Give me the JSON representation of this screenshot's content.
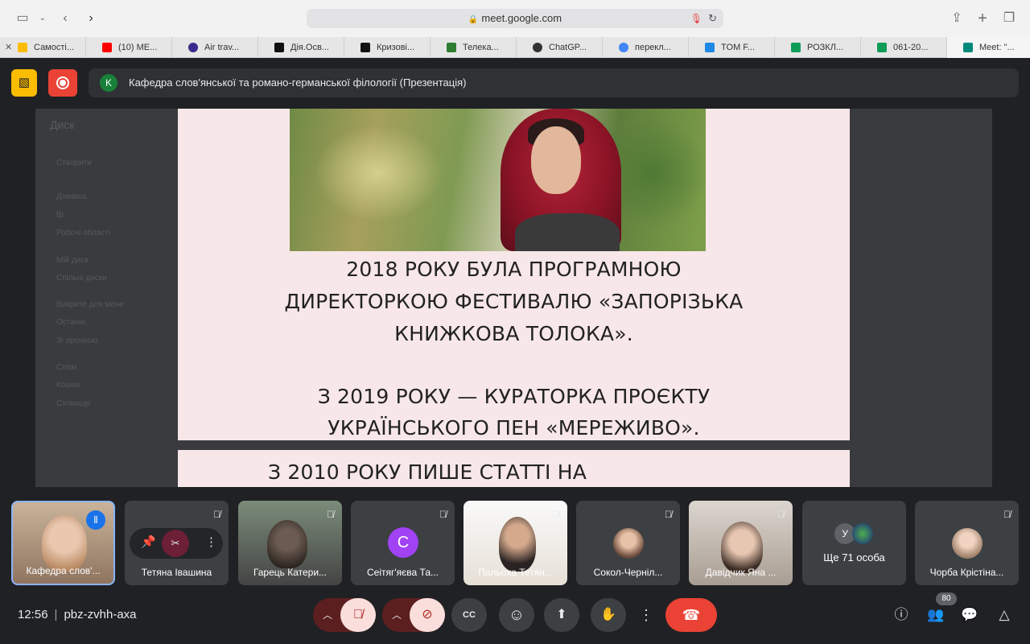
{
  "browser": {
    "url": "meet.google.com"
  },
  "tabs": [
    {
      "label": "Самості...",
      "color": "#fbbc04"
    },
    {
      "label": "(10) ME...",
      "color": "#ff0000"
    },
    {
      "label": "Air trav...",
      "color": "#3c2a8c"
    },
    {
      "label": "Дія.Осв...",
      "color": "#111111"
    },
    {
      "label": "Кризові...",
      "color": "#111111"
    },
    {
      "label": "Телека...",
      "color": "#2e7d32"
    },
    {
      "label": "ChatGP...",
      "color": "#333333"
    },
    {
      "label": "перекл...",
      "color": "#4285f4"
    },
    {
      "label": "TOM F...",
      "color": "#1e88e5"
    },
    {
      "label": "РОЗКЛ...",
      "color": "#0f9d58"
    },
    {
      "label": "061-20...",
      "color": "#0f9d58"
    },
    {
      "label": "Meet: \"...",
      "color": "#00897b"
    }
  ],
  "meeting": {
    "presenter_initial": "K",
    "title": "Кафедра слов'янської та романо-германської філології (Презентація)",
    "time": "12:56",
    "code": "pbz-zvhh-axa",
    "participant_count": "80"
  },
  "drive_bg": {
    "logo": "Диск",
    "items": [
      "Створити",
      "Домівка",
      "Ві",
      "Робочі області",
      "Мій диск",
      "Спільні диски",
      "Викрите для мене",
      "Останні",
      "Зі зірочкою",
      "Спам",
      "Кошик",
      "Сховище"
    ]
  },
  "slide": {
    "lines": [
      "2018 РОКУ БУЛА ПРОГРАМНОЮ",
      "ДИРЕКТОРКОЮ ФЕСТИВАЛЮ «ЗАПОРІЗЬКА",
      "КНИЖКОВА ТОЛОКА».",
      "",
      "З 2019 РОКУ — КУРАТОРКА ПРОЄКТУ",
      "УКРАЇНСЬКОГО ПЕН «МЕРЕЖИВО»."
    ],
    "next_line": "З 2010 РОКУ ПИШЕ СТАТТІ НА"
  },
  "participants": [
    {
      "name": "Кафедра слов'...",
      "type": "video"
    },
    {
      "name": "Тетяна Івашина",
      "type": "controls"
    },
    {
      "name": "Гарець Катери...",
      "type": "video"
    },
    {
      "name": "Сеітяг'яєва Та...",
      "type": "initial",
      "initial": "С"
    },
    {
      "name": "Пальоха Тетян...",
      "type": "video"
    },
    {
      "name": "Сокол-Черніл...",
      "type": "avatar"
    },
    {
      "name": "Давідчик Яна ...",
      "type": "video"
    },
    {
      "name": "Ще 71 особа",
      "type": "more",
      "initial": "У"
    },
    {
      "name": "Чорба Крістіна...",
      "type": "avatar"
    }
  ],
  "icons": {
    "mute": "🎤̸",
    "camera_off": "⊘",
    "captions": "CC",
    "emoji": "☺",
    "present": "⬆",
    "hand": "✋",
    "more": "⋮",
    "end": "☎"
  }
}
